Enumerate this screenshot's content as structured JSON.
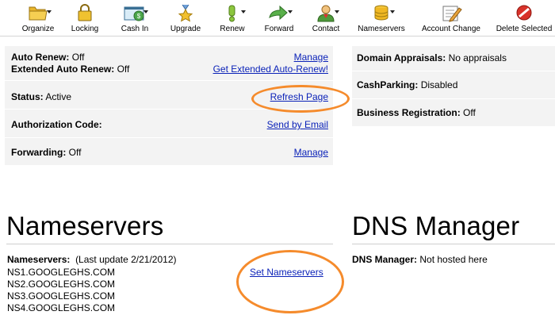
{
  "toolbar": {
    "items": [
      {
        "label": "Organize",
        "icon": "folder-icon",
        "dropdown": true
      },
      {
        "label": "Locking",
        "icon": "lock-icon",
        "dropdown": false
      },
      {
        "label": "Cash In",
        "icon": "cash-in-icon",
        "dropdown": true
      },
      {
        "label": "Upgrade",
        "icon": "upgrade-medal-icon",
        "dropdown": false
      },
      {
        "label": "Renew",
        "icon": "renew-exclamation-icon",
        "dropdown": true
      },
      {
        "label": "Forward",
        "icon": "forward-arrow-icon",
        "dropdown": true
      },
      {
        "label": "Contact",
        "icon": "contact-person-icon",
        "dropdown": true
      },
      {
        "label": "Nameservers",
        "icon": "nameservers-database-icon",
        "dropdown": true
      },
      {
        "label": "Account Change",
        "icon": "account-change-icon",
        "dropdown": false
      },
      {
        "label": "Delete Selected",
        "icon": "delete-icon",
        "dropdown": false
      }
    ]
  },
  "left_panel": {
    "auto_renew_label": "Auto Renew:",
    "auto_renew_value": "Off",
    "auto_renew_link": "Manage",
    "extended_label": "Extended Auto Renew:",
    "extended_value": "Off",
    "extended_link": "Get Extended Auto-Renew!",
    "status_label": "Status:",
    "status_value": "Active",
    "status_link": "Refresh Page",
    "auth_label": "Authorization Code:",
    "auth_link": "Send by Email",
    "forwarding_label": "Forwarding:",
    "forwarding_value": "Off",
    "forwarding_link": "Manage"
  },
  "right_panel": {
    "appraisals_label": "Domain Appraisals:",
    "appraisals_value": "No appraisals",
    "cashparking_label": "CashParking:",
    "cashparking_value": "Disabled",
    "business_label": "Business Registration:",
    "business_value": "Off"
  },
  "nameservers": {
    "title": "Nameservers",
    "label": "Nameservers:",
    "last_update": "(Last update 2/21/2012)",
    "link": "Set Nameservers",
    "list": [
      "NS1.GOOGLEGHS.COM",
      "NS2.GOOGLEGHS.COM",
      "NS3.GOOGLEGHS.COM",
      "NS4.GOOGLEGHS.COM"
    ]
  },
  "dns": {
    "title": "DNS Manager",
    "label": "DNS Manager:",
    "value": "Not hosted here"
  },
  "colors": {
    "link": "#0b22b8",
    "highlight_ellipse": "#f58b2c",
    "panel_bg": "#f3f3f3"
  }
}
